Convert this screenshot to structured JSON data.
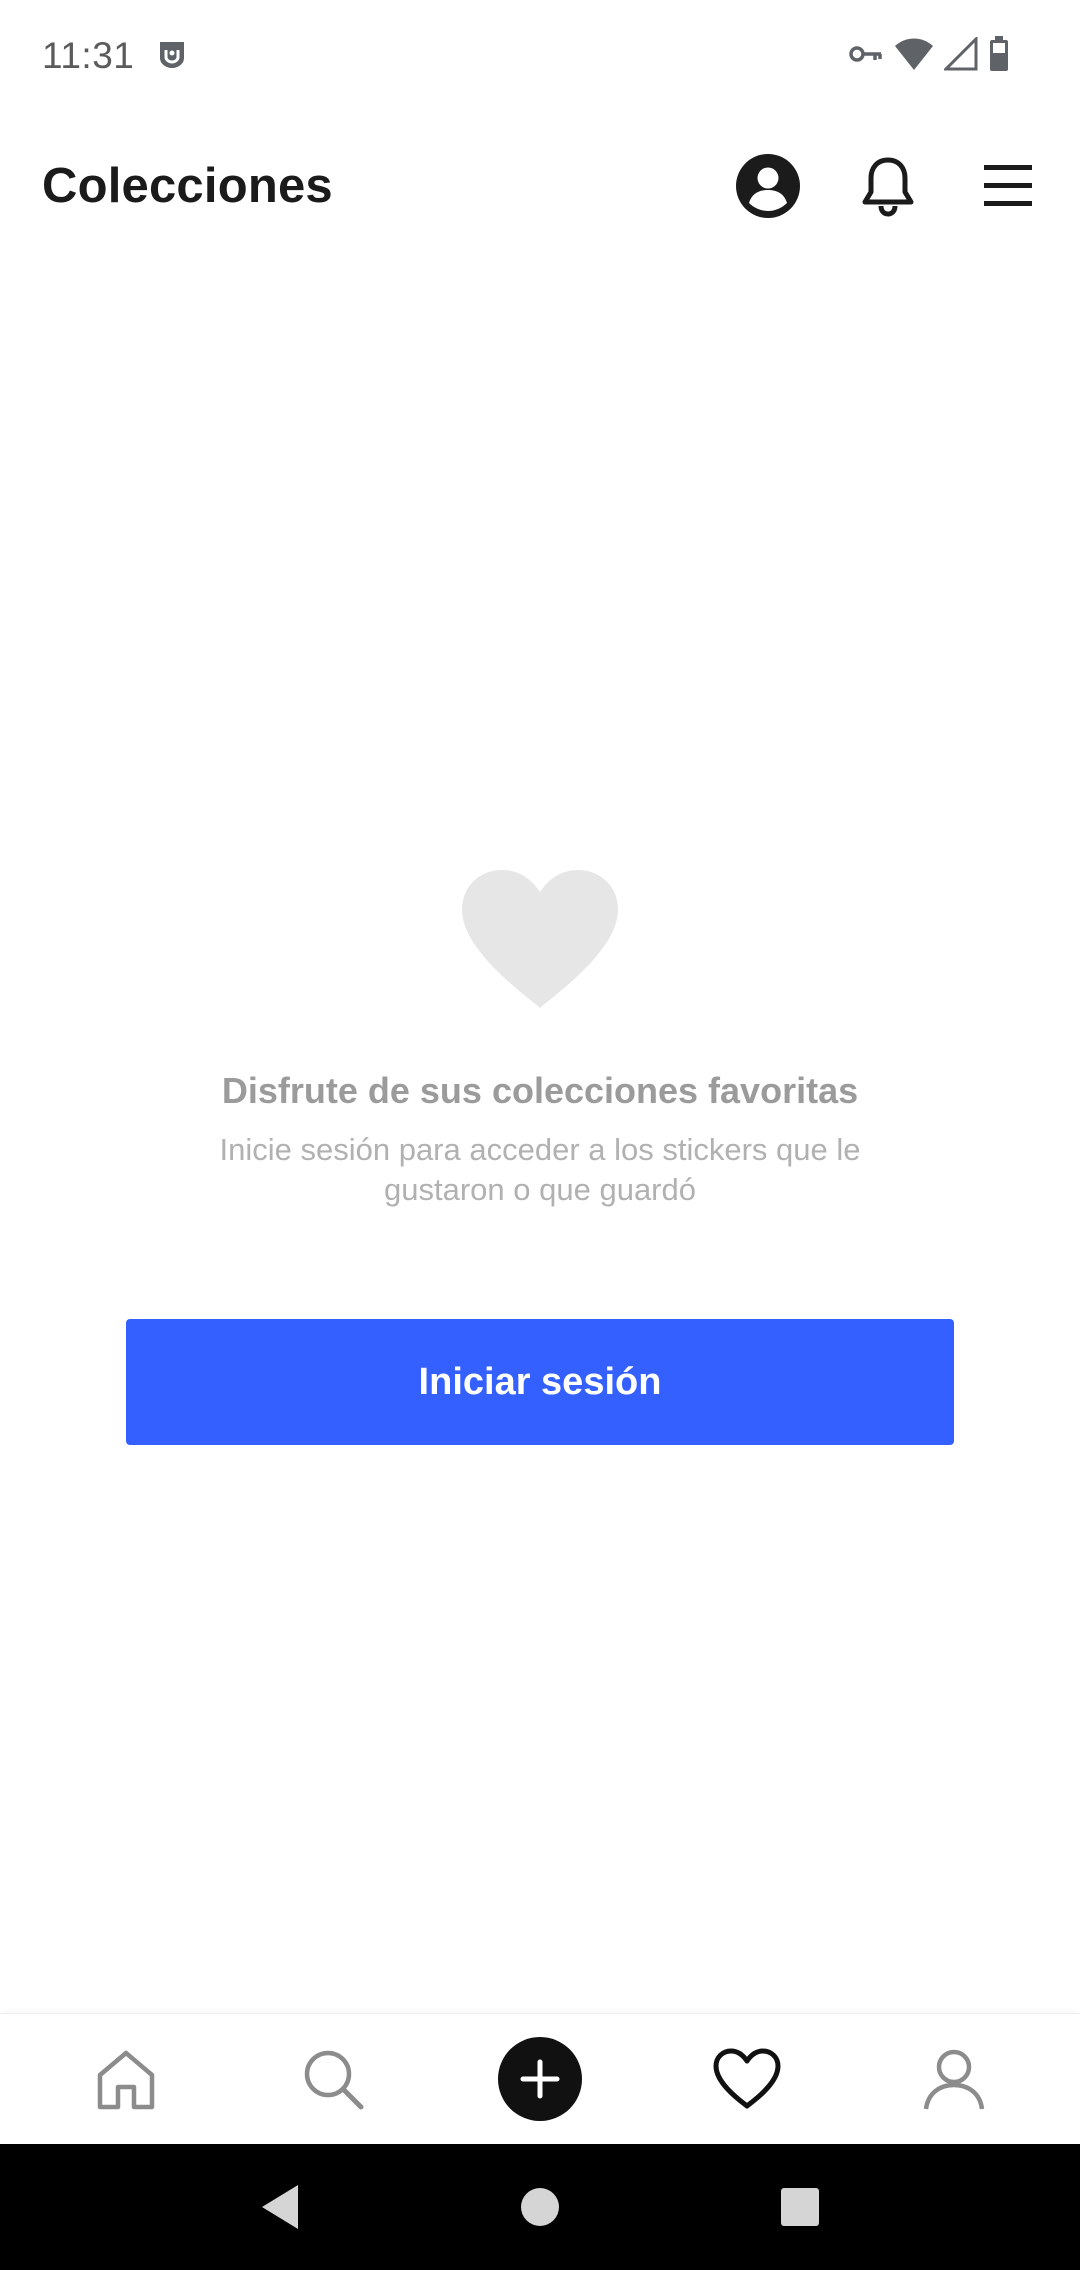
{
  "status_bar": {
    "time": "11:31",
    "icons": [
      "notification-app-icon",
      "vpn-key-icon",
      "wifi-icon",
      "cell-signal-icon",
      "battery-icon"
    ]
  },
  "header": {
    "title": "Colecciones",
    "actions": [
      "account-icon",
      "bell-icon",
      "menu-icon"
    ]
  },
  "empty_state": {
    "icon": "heart-icon",
    "title": "Disfrute de sus colecciones favoritas",
    "subtitle": "Inicie sesión para acceder a los stickers que le gustaron o que guardó",
    "button_label": "Iniciar sesión"
  },
  "bottom_nav": {
    "items": [
      "home-icon",
      "search-icon",
      "add-icon",
      "favorites-icon",
      "profile-icon"
    ],
    "active": "favorites-icon"
  },
  "system_nav": {
    "items": [
      "back-icon",
      "home-circle-icon",
      "recents-icon"
    ]
  },
  "colors": {
    "accent": "#3360ff",
    "title_text": "#1b1b1b",
    "muted_text": "#9b9b9b",
    "heart_placeholder": "#e6e6e6"
  }
}
